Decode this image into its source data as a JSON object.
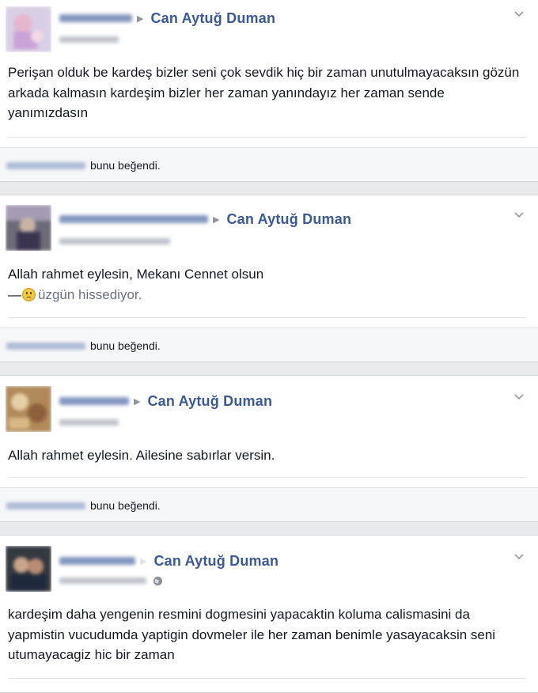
{
  "posts": [
    {
      "target_name": "Can Aytuğ Duman",
      "text": "Perişan olduk be kardeş bizler seni çok sevdik hiç bir zaman unutulmayacaksın gözün arkada kalmasın kardeşim bizler her zaman yanındayız her zaman sende yanımızdasın",
      "likes_suffix": "bunu beğendi.",
      "avatar_icon": "profile-photo-blurred"
    },
    {
      "target_name": "Can Aytuğ Duman",
      "text": "Allah rahmet eylesin, Mekanı Cennet olsun",
      "feeling_prefix": "—",
      "feeling_text": "üzgün hissediyor.",
      "feeling_icon": "sad-face-icon",
      "likes_suffix": "bunu beğendi.",
      "avatar_icon": "profile-photo-blurred"
    },
    {
      "target_name": "Can Aytuğ Duman",
      "text": "Allah rahmet eylesin. Ailesine sabırlar versin.",
      "likes_suffix": "bunu beğendi.",
      "avatar_icon": "profile-photo-blurred"
    },
    {
      "target_name": "Can Aytuğ Duman",
      "text": "kardeşim daha yengenin resmini dogmesini yapacaktin koluma calismasini da yapmistin vucudumda yaptigin dovmeler ile her zaman benimle yasayacaksin seni utumayacagiz hic bir zaman",
      "privacy_icon": "globe-icon",
      "avatar_icon": "profile-photo-blurred"
    }
  ],
  "colors": {
    "link": "#3b5998",
    "feed_background": "#e9eaed",
    "likes_bar": "#f6f7f9"
  }
}
